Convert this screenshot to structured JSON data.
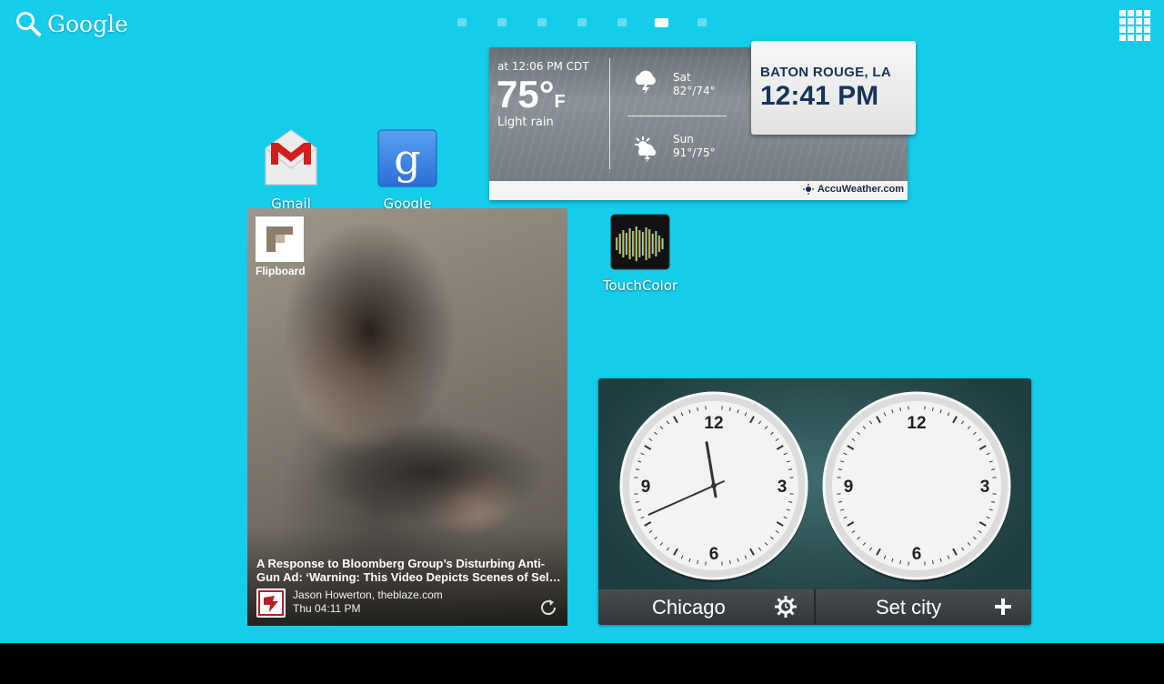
{
  "search": {
    "label": "Google"
  },
  "page_indicator": {
    "pages": 7,
    "current": 6
  },
  "apps": {
    "gmail": {
      "label": "Gmail"
    },
    "google": {
      "label": "Google"
    },
    "touchcolor": {
      "label": "TouchColor"
    }
  },
  "weather": {
    "as_of": "at 12:06 PM CDT",
    "temp": "75°",
    "unit": "F",
    "condition": "Light rain",
    "forecast": [
      {
        "day": "Sat",
        "temps": "82°/74°",
        "icon": "thunderstorm-icon"
      },
      {
        "day": "Sun",
        "temps": "91°/75°",
        "icon": "partly-cloudy-storm-icon"
      }
    ],
    "provider": "AccuWeather.com",
    "city": "BATON ROUGE, LA",
    "time": "12:41 PM"
  },
  "flipboard": {
    "brand": "Flipboard",
    "headline_line1": "A Response to Bloomberg Group’s Disturbing Anti-",
    "headline_line2": "Gun Ad: ‘Warning: This Video Depicts Scenes of Sel…",
    "author": "Jason Howerton, theblaze.com",
    "time": "Thu 04:11 PM"
  },
  "world_clock": {
    "clocks": [
      {
        "city": "Chicago",
        "hour": 11,
        "minute": 41,
        "button_icon": "alarm-settings-icon"
      },
      {
        "city": "Set city",
        "button_icon": "plus-icon"
      }
    ],
    "dial_numbers": [
      "12",
      "3",
      "6",
      "9"
    ]
  },
  "colors": {
    "wallpaper": "#15cdea",
    "nav_bar": "#000000",
    "weather_text": "#17345a"
  }
}
